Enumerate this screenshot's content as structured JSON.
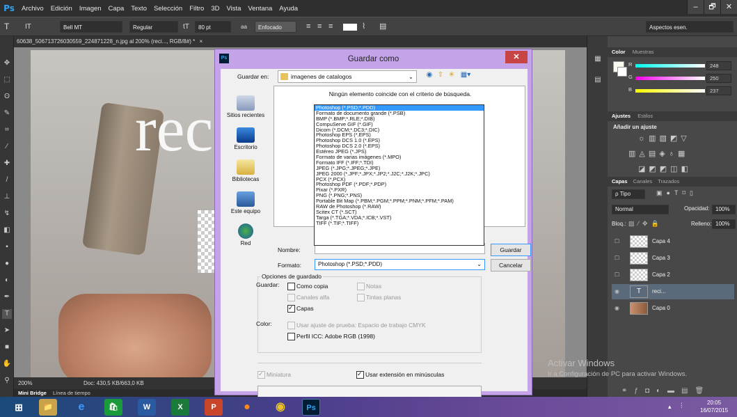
{
  "app": {
    "logo": "Ps",
    "menu": [
      "Archivo",
      "Edición",
      "Imagen",
      "Capa",
      "Texto",
      "Selección",
      "Filtro",
      "3D",
      "Vista",
      "Ventana",
      "Ayuda"
    ],
    "window_buttons": [
      "–",
      "🗗",
      "✕"
    ]
  },
  "options_bar": {
    "tool_icon": "T",
    "orient_icon": "IT",
    "font_family": "Bell MT",
    "font_style": "Regular",
    "size_icon": "tT",
    "font_size": "80 pt",
    "aa_icon": "aa",
    "antialias": "Enfocado",
    "workspace": "Aspectos esen."
  },
  "document": {
    "tab_title": "60638_506713726030559_224871228_n.jpg al 200% (reci..., RGB/8#) *",
    "tab_close": "×",
    "canvas_text": "rec",
    "zoom": "200%",
    "doc_info": "Doc: 430,5 KB/663,0 KB"
  },
  "timeline": {
    "tabs": [
      "Mini Bridge",
      "Línea de tiempo"
    ]
  },
  "dialog": {
    "title": "Guardar como",
    "close": "✕",
    "icon": "Ps",
    "look_in_label": "Guardar en:",
    "look_in_value": "imagenes de catalogos",
    "no_match": "Ningún elemento coincide con el criterio de búsqueda.",
    "places": [
      "Sitios recientes",
      "Escritorio",
      "Bibliotecas",
      "Este equipo",
      "Red"
    ],
    "name_label": "Nombre:",
    "format_label": "Formato:",
    "format_value": "Photoshop (*.PSD;*.PDD)",
    "save_button": "Guardar",
    "cancel_button": "Cancelar",
    "format_options": [
      "Photoshop (*.PSD;*.PDD)",
      "Formato de documento grande (*.PSB)",
      "BMP (*.BMP;*.RLE;*.DIB)",
      "CompuServe GIF (*.GIF)",
      "Dicom (*.DCM;*.DC3;*.DIC)",
      "Photoshop EPS (*.EPS)",
      "Photoshop DCS 1.0 (*.EPS)",
      "Photoshop DCS 2.0 (*.EPS)",
      "Estéreo JPEG (*.JPS)",
      "Formato de varias imágenes (*.MPO)",
      "Formato IFF (*.IFF;*.TDI)",
      "JPEG (*.JPG;*.JPEG;*.JPE)",
      "JPEG 2000 (*.JPF;*.JPX;*.JP2;*.J2C;*.J2K;*.JPC)",
      "PCX (*.PCX)",
      "Photoshop PDF (*.PDF;*.PDP)",
      "Pixar (*.PXR)",
      "PNG (*.PNG;*.PNS)",
      "Portable Bit Map (*.PBM;*.PGM;*.PPM;*.PNM;*.PFM;*.PAM)",
      "RAW de Photoshop (*.RAW)",
      "Scitex CT (*.SCT)",
      "Targa (*.TGA;*.VDA;*.ICB;*.VST)",
      "TIFF (*.TIF;*.TIFF)"
    ],
    "save_options": {
      "title": "Opciones de guardado",
      "save_label": "Guardar:",
      "copy": "Como copia",
      "notes": "Notas",
      "alpha": "Canales alfa",
      "spot": "Tintas planas",
      "layers": "Capas",
      "color_label": "Color:",
      "proof": "Usar ajuste de prueba: Espacio de trabajo CMYK",
      "icc": "Perfil ICC: Adobe RGB (1998)",
      "thumbnail": "Miniatura",
      "lowercase": "Usar extensión en minúsculas"
    }
  },
  "panels": {
    "color_tabs": [
      "Color",
      "Muestras"
    ],
    "channels": [
      {
        "label": "R",
        "value": "248"
      },
      {
        "label": "G",
        "value": "250"
      },
      {
        "label": "B",
        "value": "237"
      }
    ],
    "adjust_tabs": [
      "Ajustes",
      "Estilos"
    ],
    "add_adjust": "Añadir un ajuste",
    "layer_tabs": [
      "Capas",
      "Canales",
      "Trazados"
    ],
    "kind_filter": "ρ Tipo",
    "blend_mode": "Normal",
    "opacity_label": "Opacidad:",
    "opacity_value": "100%",
    "lock_label": "Bloq.:",
    "fill_label": "Relleno:",
    "fill_value": "100%",
    "layers": [
      "Capa 4",
      "Capa 3",
      "Capa 2",
      "reci...",
      "Capa 0"
    ]
  },
  "watermark": {
    "line1": "Activar Windows",
    "line2": "Ir a Configuración de PC para activar Windows."
  },
  "taskbar": {
    "time": "20:05",
    "date": "16/07/2015",
    "apps": [
      "⊞",
      "📁",
      "e",
      "🛍",
      "W",
      "X",
      "P",
      "●",
      "◉",
      "Ps"
    ]
  },
  "colors": {
    "accent": "#2fa3f5",
    "dialog_frame": "#c5a3e8",
    "selection": "#3399ff"
  }
}
